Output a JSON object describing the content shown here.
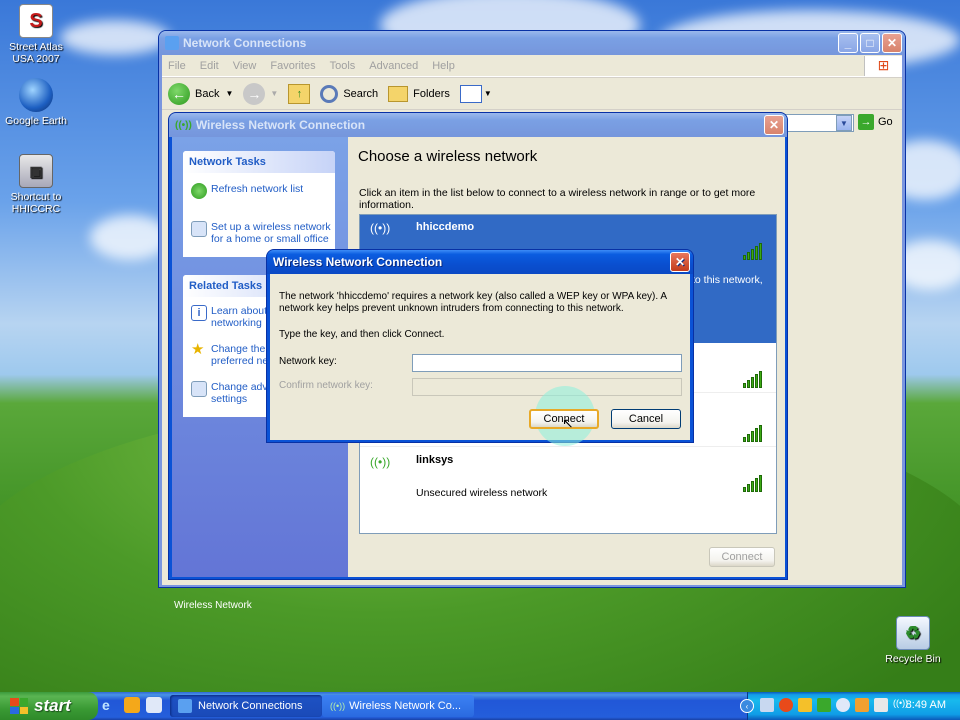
{
  "desktop": {
    "icons": [
      {
        "label_line1": "Street Atlas",
        "label_line2": "USA 2007",
        "icon": "street-atlas-icon"
      },
      {
        "label_line1": "Google Earth",
        "label_line2": "",
        "icon": "google-earth-icon"
      },
      {
        "label_line1": "Shortcut to",
        "label_line2": "HHICCRC",
        "icon": "computer-shortcut-icon"
      },
      {
        "label_line1": "Recycle Bin",
        "label_line2": "",
        "icon": "recycle-bin-icon"
      }
    ]
  },
  "explorer": {
    "title": "Network Connections",
    "menu": [
      "File",
      "Edit",
      "View",
      "Favorites",
      "Tools",
      "Advanced",
      "Help"
    ],
    "toolbar": {
      "back": "Back",
      "search": "Search",
      "folders": "Folders"
    },
    "address_go": "Go",
    "bottom_label": "Wireless Network"
  },
  "wireless_window": {
    "title": "Wireless Network Connection",
    "network_tasks": {
      "header": "Network Tasks",
      "items": [
        "Refresh network list",
        "Set up a wireless network for a home or small office"
      ]
    },
    "related_tasks": {
      "header": "Related Tasks",
      "items": [
        "Learn about wireless networking",
        "Change the order of preferred networks",
        "Change advanced settings"
      ]
    },
    "heading": "Choose a wireless network",
    "instruction": "Click an item in the list below to connect to a wireless network in range or to get more information.",
    "networks": [
      {
        "name": "hhiccdemo",
        "status": "",
        "extra": "to this network,",
        "selected": true
      },
      {
        "name": "",
        "status": "",
        "selected": false
      },
      {
        "name": "",
        "status": "",
        "selected": false
      },
      {
        "name": "linksys",
        "status": "Unsecured wireless network",
        "selected": false
      }
    ],
    "connect_label": "Connect"
  },
  "dialog": {
    "title": "Wireless Network Connection",
    "message": "The network 'hhiccdemo' requires a network key (also called a WEP key or WPA key). A network key helps prevent unknown intruders from connecting to this network.",
    "prompt": "Type the key, and then click Connect.",
    "network_key_label": "Network key:",
    "network_key_value": "",
    "confirm_label": "Confirm network key:",
    "confirm_value": "",
    "connect_button": "Connect",
    "cancel_button": "Cancel"
  },
  "taskbar": {
    "start": "start",
    "tasks": [
      "Network Connections",
      "Wireless Network Co..."
    ],
    "clock": "8:49 AM"
  }
}
